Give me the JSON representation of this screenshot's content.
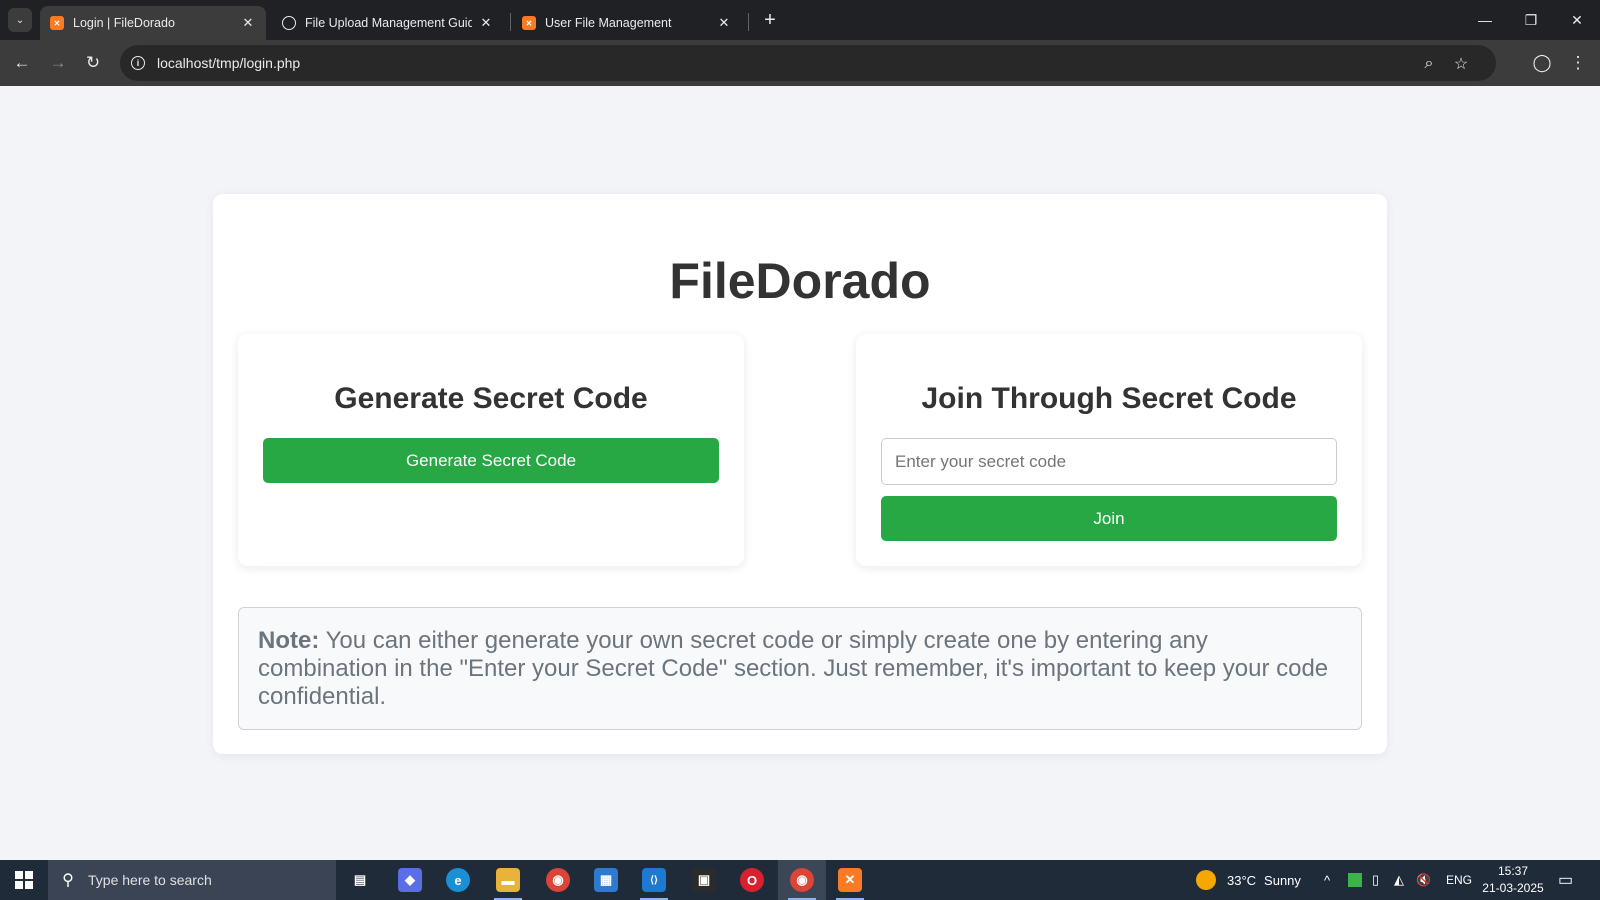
{
  "browser": {
    "tabs": [
      {
        "title": "Login | FileDorado",
        "favicon": "xampp-icon",
        "active": true
      },
      {
        "title": "File Upload Management Guide",
        "favicon": "globe-icon",
        "active": false
      },
      {
        "title": "User File Management",
        "favicon": "xampp-icon",
        "active": false
      }
    ],
    "close_glyph": "✕",
    "new_tab_glyph": "+",
    "tab_menu_glyph": "⌄",
    "url": "localhost/tmp/login.php",
    "info_glyph": "i",
    "nav": {
      "back": "←",
      "forward": "→",
      "reload": "↻"
    },
    "omnibox_icons": {
      "zoom": "⌕",
      "star": "☆"
    },
    "profile_glyph": "◯",
    "menu_glyph": "⋮",
    "window_controls": {
      "minimize": "—",
      "restore": "❐",
      "close": "✕"
    }
  },
  "page": {
    "brand": "FileDorado",
    "generate_panel": {
      "heading": "Generate Secret Code",
      "button_label": "Generate Secret Code"
    },
    "join_panel": {
      "heading": "Join Through Secret Code",
      "input_placeholder": "Enter your secret code",
      "input_value": "",
      "button_label": "Join"
    },
    "note": {
      "label": "Note:",
      "text": "You can either generate your own secret code or simply create one by entering any combination in the \"Enter your Secret Code\" section. Just remember, it's important to keep your code confidential."
    },
    "colors": {
      "accent_green": "#28a745",
      "background": "#f3f4f8"
    }
  },
  "taskbar": {
    "search_placeholder": "Type here to search",
    "search_glyph": "⚲",
    "apps": [
      {
        "name": "task-view",
        "glyph": "▤",
        "color": "#202b3a"
      },
      {
        "name": "copilot",
        "glyph": "◆",
        "color": "#5a6ee6"
      },
      {
        "name": "edge",
        "glyph": "e",
        "color": "#1a8fd6"
      },
      {
        "name": "file-explorer",
        "glyph": "▬",
        "color": "#e8b33a"
      },
      {
        "name": "chrome",
        "glyph": "◉",
        "color": "#db4437"
      },
      {
        "name": "store",
        "glyph": "▦",
        "color": "#2f7ad1"
      },
      {
        "name": "vscode",
        "glyph": "⟨⟩",
        "color": "#1e7ad1"
      },
      {
        "name": "media-app",
        "glyph": "▣",
        "color": "#2b2b2b"
      },
      {
        "name": "opera",
        "glyph": "O",
        "color": "#d8202f"
      },
      {
        "name": "chrome-profile",
        "glyph": "◉",
        "color": "#db4437"
      },
      {
        "name": "xampp",
        "glyph": "✕",
        "color": "#fb7a24"
      }
    ],
    "weather": {
      "temperature": "33°C",
      "condition": "Sunny"
    },
    "tray_glyphs": {
      "chevron": "^",
      "network": "◭",
      "speaker": "🔇"
    },
    "language": "ENG",
    "time": "15:37",
    "date": "21-03-2025",
    "notification_glyph": "▭"
  }
}
